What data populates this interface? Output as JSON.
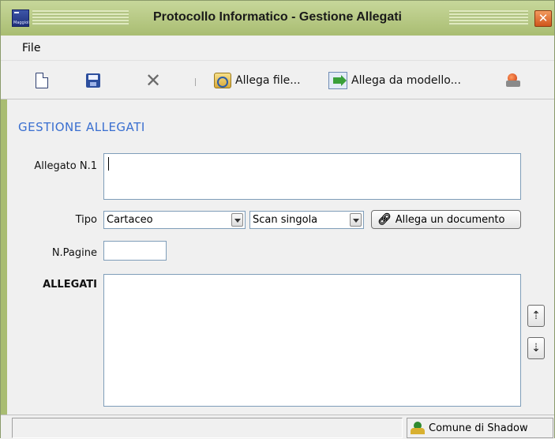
{
  "window": {
    "title": "Protocollo Informatico - Gestione Allegati",
    "app_icon_text": "Maggioli",
    "close_symbol": "✕"
  },
  "menu": {
    "items": [
      "File"
    ]
  },
  "toolbar": {
    "new_icon": "new-document-icon",
    "save_icon": "save-icon",
    "delete_symbol": "✕",
    "attach_file_label": "Allega file...",
    "attach_model_label": "Allega da modello...",
    "print_icon": "print-icon"
  },
  "form": {
    "section_title": "GESTIONE ALLEGATI",
    "allegato_label": "Allegato N.1",
    "allegato_value": "",
    "tipo_label": "Tipo",
    "tipo_value": "Cartaceo",
    "scan_value": "Scan singola",
    "attach_document_label": "Allega un documento",
    "pagine_label": "N.Pagine",
    "pagine_value": "",
    "allegati_label": "ALLEGATI",
    "move_up_symbol": "⇡",
    "move_down_symbol": "⇣"
  },
  "status": {
    "left_text": "",
    "right_text": "Comune di Shadow"
  },
  "colors": {
    "titlebar": "#b5c883",
    "section_title": "#3a6fd0",
    "close_button": "#e06a2a"
  }
}
